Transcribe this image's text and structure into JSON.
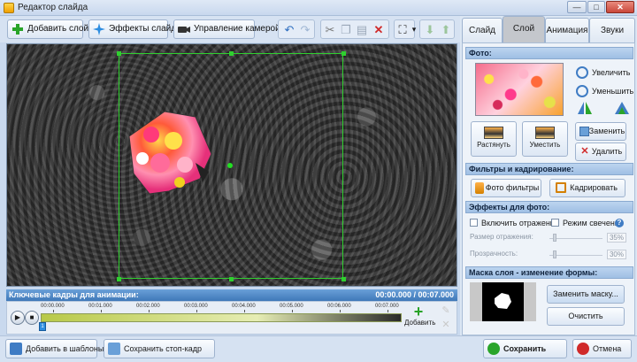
{
  "window": {
    "title": "Редактор слайда",
    "min": "—",
    "max": "□",
    "close": "✕"
  },
  "toolbar": {
    "add_layer": "Добавить слой",
    "slide_effects": "Эффекты слайда",
    "camera_control": "Управление камерой",
    "zoom_menu_arrow": "▾"
  },
  "timeline": {
    "header": "Ключевые кадры для анимации:",
    "time": "00:00.000 / 00:07.000",
    "ticks": [
      "00:00.000",
      "00:01.000",
      "00:02.000",
      "00:03.000",
      "00:04.000",
      "00:05.000",
      "00:06.000",
      "00:07.000"
    ],
    "add_label": "Добавить",
    "keyframe_index": "1"
  },
  "bottom": {
    "add_to_templates": "Добавить в шаблоны",
    "save_still": "Сохранить стоп-кадр",
    "save": "Сохранить",
    "cancel": "Отмена"
  },
  "tabs": [
    "Слайд",
    "Слой",
    "Анимация",
    "Звуки"
  ],
  "active_tab": "Слой",
  "photo": {
    "section": "Фото:",
    "zoom_in": "Увеличить",
    "zoom_out": "Уменьшить",
    "stretch": "Растянуть",
    "fit": "Уместить",
    "replace": "Заменить",
    "delete": "Удалить"
  },
  "filters": {
    "section": "Фильтры и кадрирование:",
    "photo_filters": "Фото фильтры",
    "crop": "Кадрировать"
  },
  "effects": {
    "section": "Эффекты для фото:",
    "reflection": "Включить отражение",
    "glow": "Режим свечения",
    "reflection_size_label": "Размер отражения:",
    "reflection_size_value": "35%",
    "transparency_label": "Прозрачность:",
    "transparency_value": "30%"
  },
  "mask": {
    "section": "Маска слоя - изменение формы:",
    "replace_mask": "Заменить маску...",
    "clear": "Очистить"
  },
  "colors": {
    "guide": "#2fd02f",
    "timeline_header": "#3f78b8",
    "delete_red": "#d02a2a"
  }
}
